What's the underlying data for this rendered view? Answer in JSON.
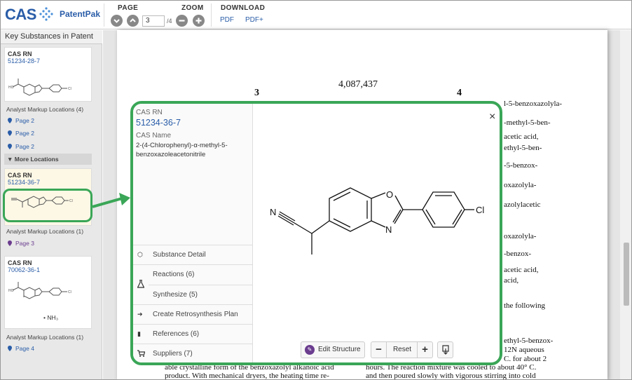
{
  "header": {
    "logo": "CAS",
    "product": "PatentPak",
    "page_label": "PAGE",
    "zoom_label": "ZOOM",
    "download_label": "DOWNLOAD",
    "page_value": "3",
    "page_total": "/4",
    "pdf": "PDF",
    "pdf_plus": "PDF+"
  },
  "sidebar": {
    "title": "Key Substances in Patent",
    "cards": [
      {
        "rn_label": "CAS RN",
        "rn": "51234-28-7",
        "loc_label": "Analyst Markup Locations (4)",
        "locations": [
          "Page 2",
          "Page 2",
          "Page 2"
        ]
      },
      {
        "rn_label": "CAS RN",
        "rn": "51234-36-7",
        "loc_label": "Analyst Markup Locations (1)",
        "locations": [
          "Page 3"
        ]
      },
      {
        "rn_label": "CAS RN",
        "rn": "70062-36-1",
        "loc_label": "Analyst Markup Locations (1)",
        "locations": [
          "Page 4"
        ],
        "extra": "• NH₃"
      }
    ],
    "more_locations": "▼ More Locations"
  },
  "document": {
    "patent_number": "4,087,437",
    "col_left": "3",
    "col_right": "4",
    "right_lines": [
      "l-5-benzoxazolyla-",
      "-methyl-5-ben-",
      "acetic acid,",
      "ethyl-5-ben-",
      "-5-benzox-",
      "oxazolyla-",
      "azolylacetic",
      "oxazolyla-",
      "-benzox-",
      "acetic acid,",
      "acid,",
      "the following",
      "ethyl-5-benzox-",
      "12N  aqueous",
      "C. for about 2",
      "hours. The reaction mixture was cooled to about 40° C.",
      "and then poured slowly with vigorous stirring into cold"
    ],
    "left_lines": [
      "able crystalline form of the benzoxazolyl alkanoic acid",
      "product. With mechanical dryers, the heating time re-"
    ]
  },
  "popup": {
    "rn_label": "CAS RN",
    "rn": "51234-36-7",
    "name_label": "CAS Name",
    "name": "2-(4-Chlorophenyl)-α-methyl-5-benzoxazoleacetonitrile",
    "menu": [
      {
        "icon": "substance-icon",
        "label": "Substance Detail"
      },
      {
        "icon": "",
        "label": "Reactions (6)"
      },
      {
        "icon": "flask-icon",
        "label": "Synthesize (5)"
      },
      {
        "icon": "retro-icon",
        "label": "Create Retrosynthesis Plan"
      },
      {
        "icon": "book-icon",
        "label": "References (6)"
      },
      {
        "icon": "cart-icon",
        "label": "Suppliers (7)"
      }
    ],
    "edit_structure": "Edit Structure",
    "reset": "Reset",
    "zoom_minus": "−",
    "zoom_plus": "+",
    "close": "×",
    "atoms": {
      "o": "O",
      "n_ring": "N",
      "n_nitrile": "N",
      "cl": "Cl"
    }
  },
  "colors": {
    "accent": "#2a5da8",
    "highlight": "#3aa657",
    "edit_icon": "#6b3d8f"
  }
}
